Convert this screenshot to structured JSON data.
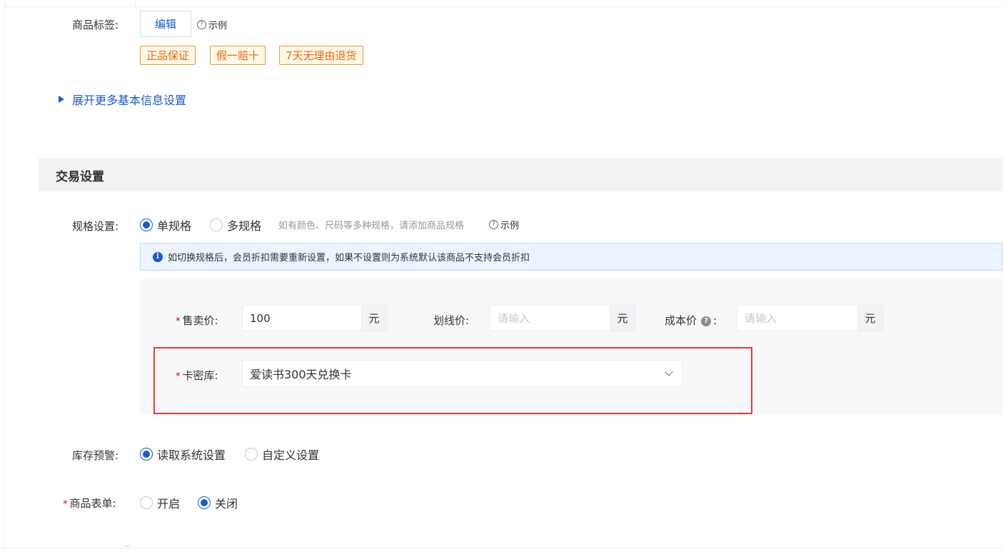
{
  "tags_row": {
    "label": "商品标签:",
    "edit_button": "编辑",
    "example": "示例",
    "tags": [
      "正品保证",
      "假一赔十",
      "7天无理由退货"
    ]
  },
  "expand_link": "展开更多基本信息设置",
  "trade_section": {
    "title": "交易设置"
  },
  "spec": {
    "label": "规格设置:",
    "options": [
      "单规格",
      "多规格"
    ],
    "selected": "单规格",
    "hint": "如有颜色、尺码等多种规格，请添加商品规格",
    "example": "示例"
  },
  "notice": {
    "icon": "i",
    "text": "如切换规格后，会员折扣需要重新设置，如果不设置则为系统默认该商品不支持会员折扣"
  },
  "prices": {
    "sale": {
      "label": "售卖价:",
      "value": "100",
      "unit": "元"
    },
    "strike": {
      "label": "划线价:",
      "placeholder": "请输入",
      "unit": "元"
    },
    "cost": {
      "label": "成本价",
      "colon": ":",
      "placeholder": "请输入",
      "unit": "元",
      "help_icon": "?"
    }
  },
  "card_lib": {
    "label": "卡密库:",
    "value": "爱读书300天兑换卡"
  },
  "stock_warning": {
    "label": "库存预警:",
    "options": [
      "读取系统设置",
      "自定义设置"
    ],
    "selected": "读取系统设置"
  },
  "product_form": {
    "label": "商品表单:",
    "options": [
      "开启",
      "关闭"
    ],
    "selected": "关闭"
  },
  "required_mark": "*",
  "colors": {
    "primary": "#155bd4",
    "tag_border": "#ed9b27",
    "tag_text": "#ed6a0c",
    "highlight_box": "#e53935",
    "required": "#d40000"
  }
}
